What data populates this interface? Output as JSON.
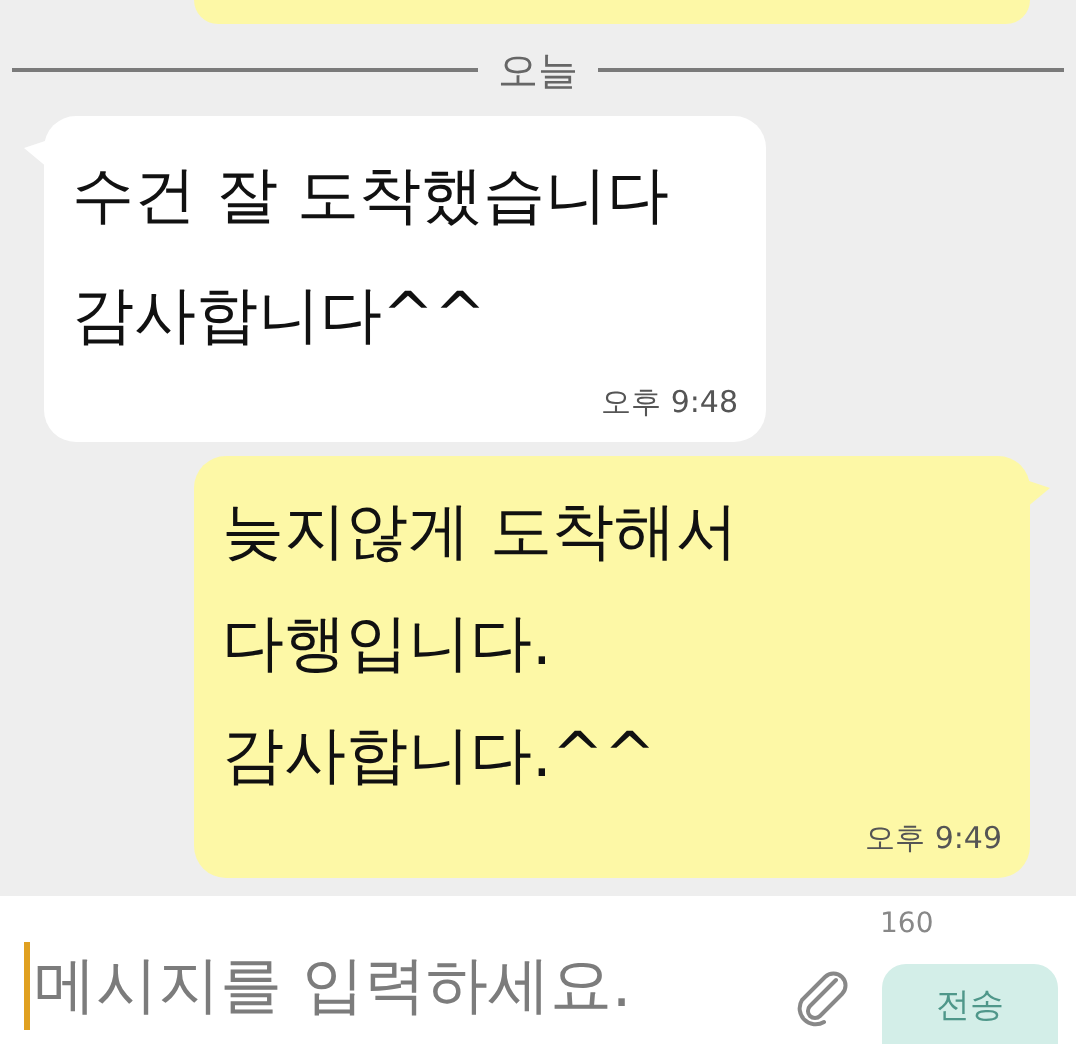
{
  "date_divider": {
    "label": "오늘"
  },
  "messages": [
    {
      "kind": "incoming",
      "lines": [
        "수건 잘 도착했습니다",
        "감사합니다^^"
      ],
      "time": "오후 9:48"
    },
    {
      "kind": "outgoing",
      "lines": [
        "늦지않게 도착해서",
        "다행입니다.",
        "감사합니다.^^"
      ],
      "time": "오후 9:49"
    }
  ],
  "composer": {
    "placeholder": "메시지를 입력하세요.",
    "counter": "160",
    "send_button": {
      "label": "전송",
      "disabled": true
    }
  }
}
